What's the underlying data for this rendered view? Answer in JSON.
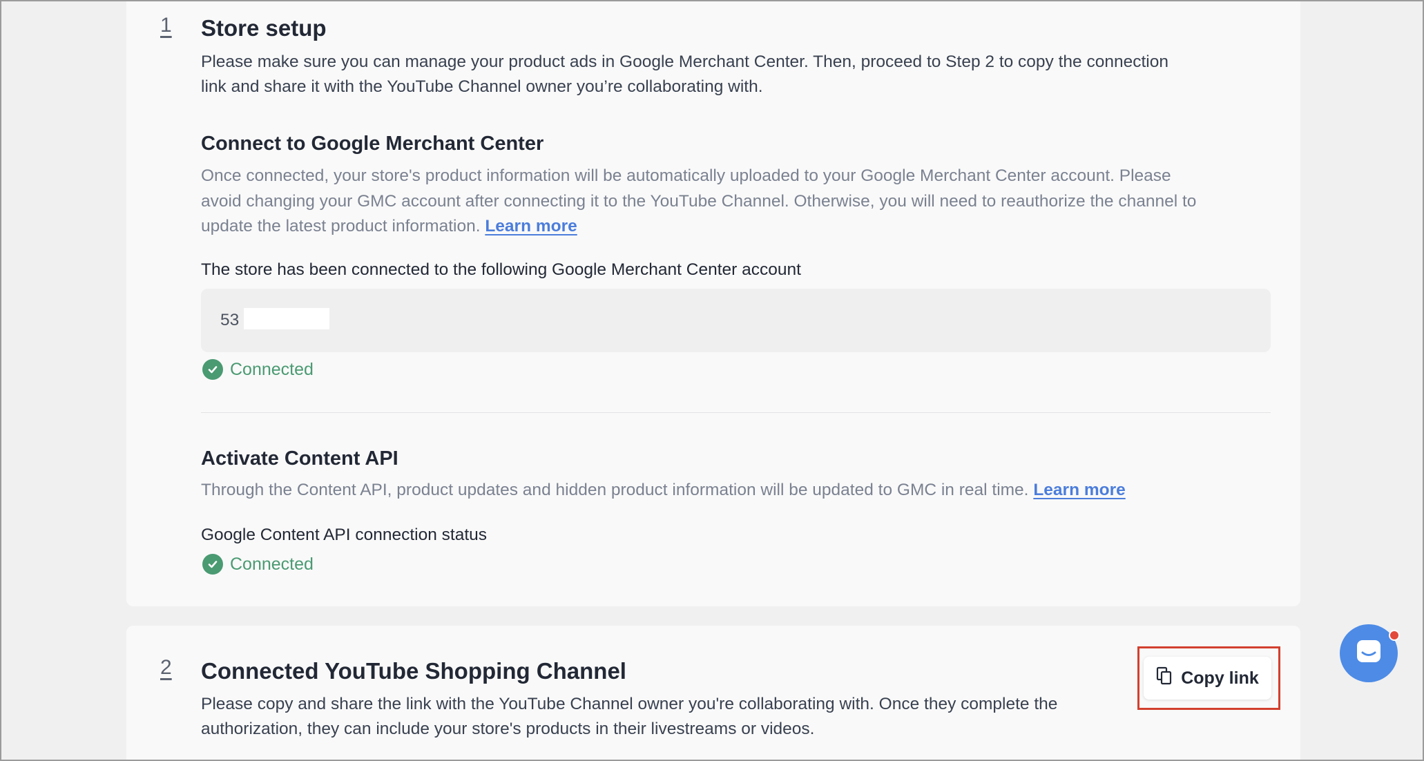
{
  "step1": {
    "number": "1",
    "title": "Store setup",
    "description_line1": "Please make sure you can manage your product ads in Google Merchant Center. Then, proceed to Step 2 to copy the connection",
    "description_line2": "link and share it with the YouTube Channel owner you’re collaborating with.",
    "gmc": {
      "title": "Connect to Google Merchant Center",
      "description_line1": "Once connected, your store's product information will be automatically uploaded to your Google Merchant Center account. Please",
      "description_line2": "avoid changing your GMC account after connecting it to the YouTube Channel. Otherwise, you will need to reauthorize the channel to",
      "description_line3": "update the latest product information.",
      "learn_more": "Learn more",
      "account_label": "The store has been connected to the following Google Merchant Center account",
      "account_value": "53",
      "status": "Connected"
    },
    "content_api": {
      "title": "Activate Content API",
      "description": "Through the Content API, product updates and hidden product information will be updated to GMC in real time.",
      "learn_more": "Learn more",
      "status_label": "Google Content API connection status",
      "status": "Connected"
    }
  },
  "step2": {
    "number": "2",
    "title": "Connected YouTube Shopping Channel",
    "description_line1": "Please copy and share the link with the YouTube Channel owner you're collaborating with. Once they complete the",
    "description_line2": "authorization, they can include your store's products in their livestreams or videos.",
    "copy_link_label": "Copy link"
  },
  "colors": {
    "success": "#4a9a72",
    "link": "#4b7ddb",
    "highlight": "#d2402e",
    "chat": "#4d8be6"
  },
  "icons": [
    "check-circle-icon",
    "copy-icon",
    "chat-icon"
  ]
}
